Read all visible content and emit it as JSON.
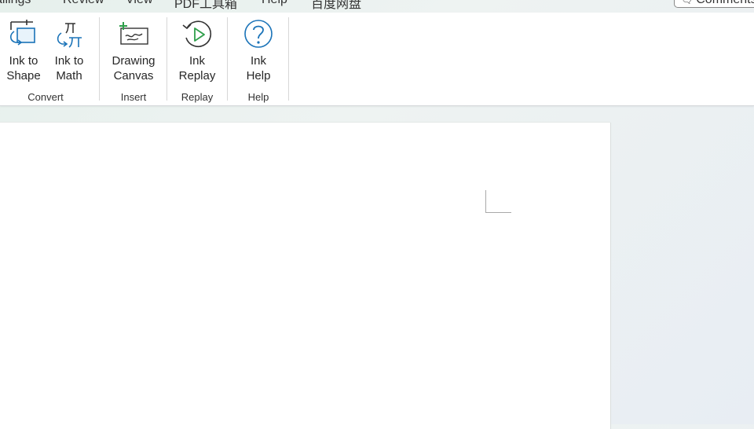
{
  "tabs": [
    {
      "label": "ailings"
    },
    {
      "label": "Review"
    },
    {
      "label": "View"
    },
    {
      "label": "PDF工具箱"
    },
    {
      "label": "Help"
    },
    {
      "label": "百度网盘"
    }
  ],
  "comment_button": {
    "label": "Comments",
    "icon": "comment-icon"
  },
  "ribbon": {
    "buttons": {
      "ink_to_shape": {
        "label": "Ink to\nShape",
        "icon": "ink-to-shape-icon"
      },
      "ink_to_math": {
        "label": "Ink to\nMath",
        "icon": "ink-to-math-icon"
      },
      "drawing_canvas": {
        "label": "Drawing\nCanvas",
        "icon": "drawing-canvas-icon"
      },
      "ink_replay": {
        "label": "Ink\nReplay",
        "icon": "ink-replay-icon"
      },
      "ink_help": {
        "label": "Ink\nHelp",
        "icon": "help-icon"
      }
    },
    "groups": {
      "convert": "Convert",
      "insert": "Insert",
      "replay": "Replay",
      "help": "Help"
    }
  },
  "colors": {
    "accent_blue": "#1a73b8",
    "accent_green": "#2e9e4a"
  }
}
